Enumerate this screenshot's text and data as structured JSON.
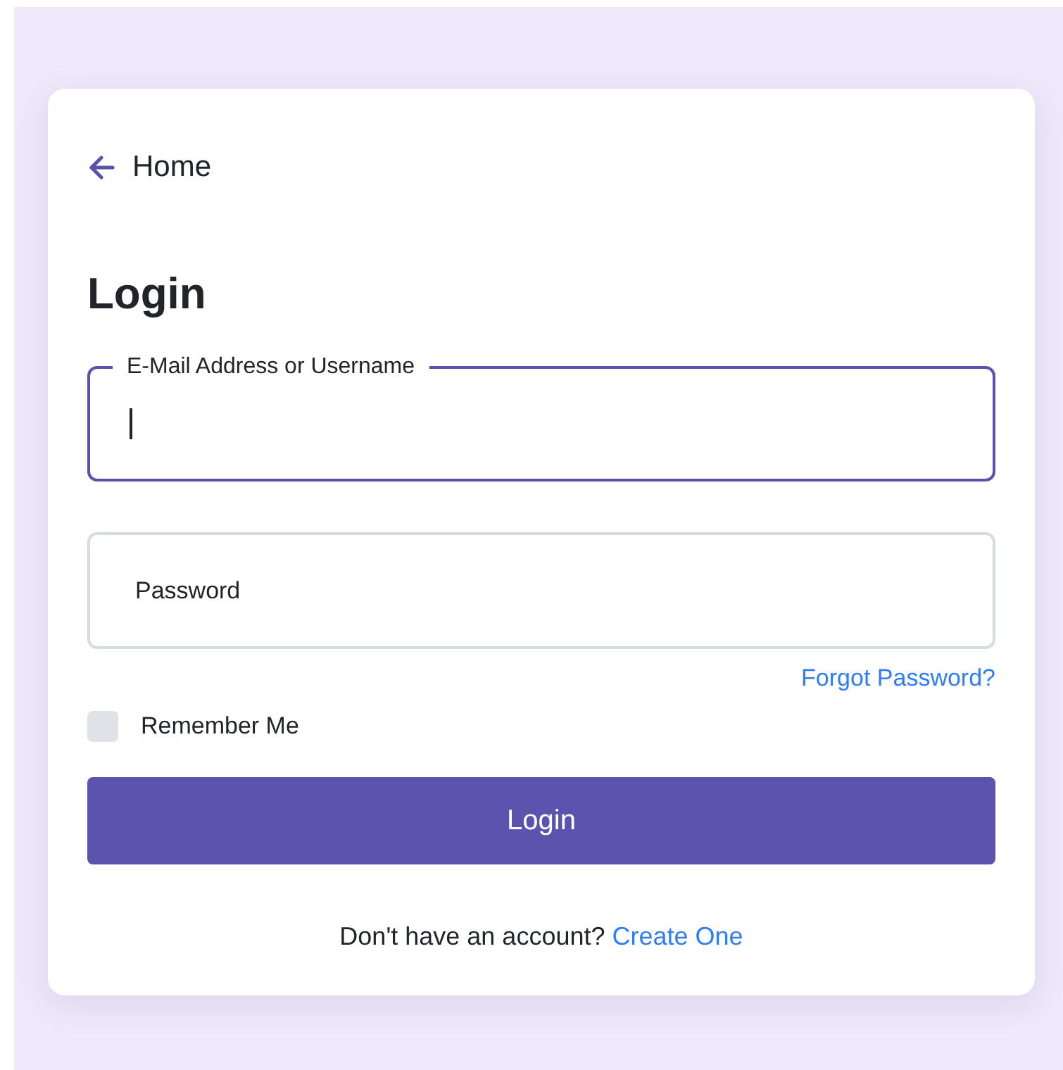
{
  "back_link": {
    "label": "Home"
  },
  "title": "Login",
  "fields": [
    {
      "label": "E-Mail Address or Username",
      "focused": true
    },
    {
      "label": "Password",
      "focused": false
    }
  ],
  "forgot_link": "Forgot Password?",
  "remember": {
    "label": "Remember Me",
    "checked": false
  },
  "submit": "Login",
  "footer": {
    "text": "Don't have an account?",
    "link": "Create One"
  }
}
